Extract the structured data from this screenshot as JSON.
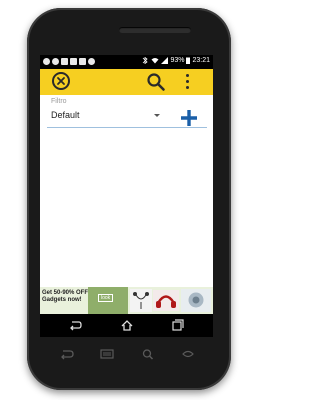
{
  "status_bar": {
    "battery": "93%",
    "time": "23:21"
  },
  "filter": {
    "label": "Filtro",
    "selected": "Default"
  },
  "ad": {
    "text": "Get 50-90% OFF Gadgets now!",
    "badge": "look"
  },
  "colors": {
    "appbar": "#f6cf21",
    "accent_blue": "#1a5fa8"
  }
}
